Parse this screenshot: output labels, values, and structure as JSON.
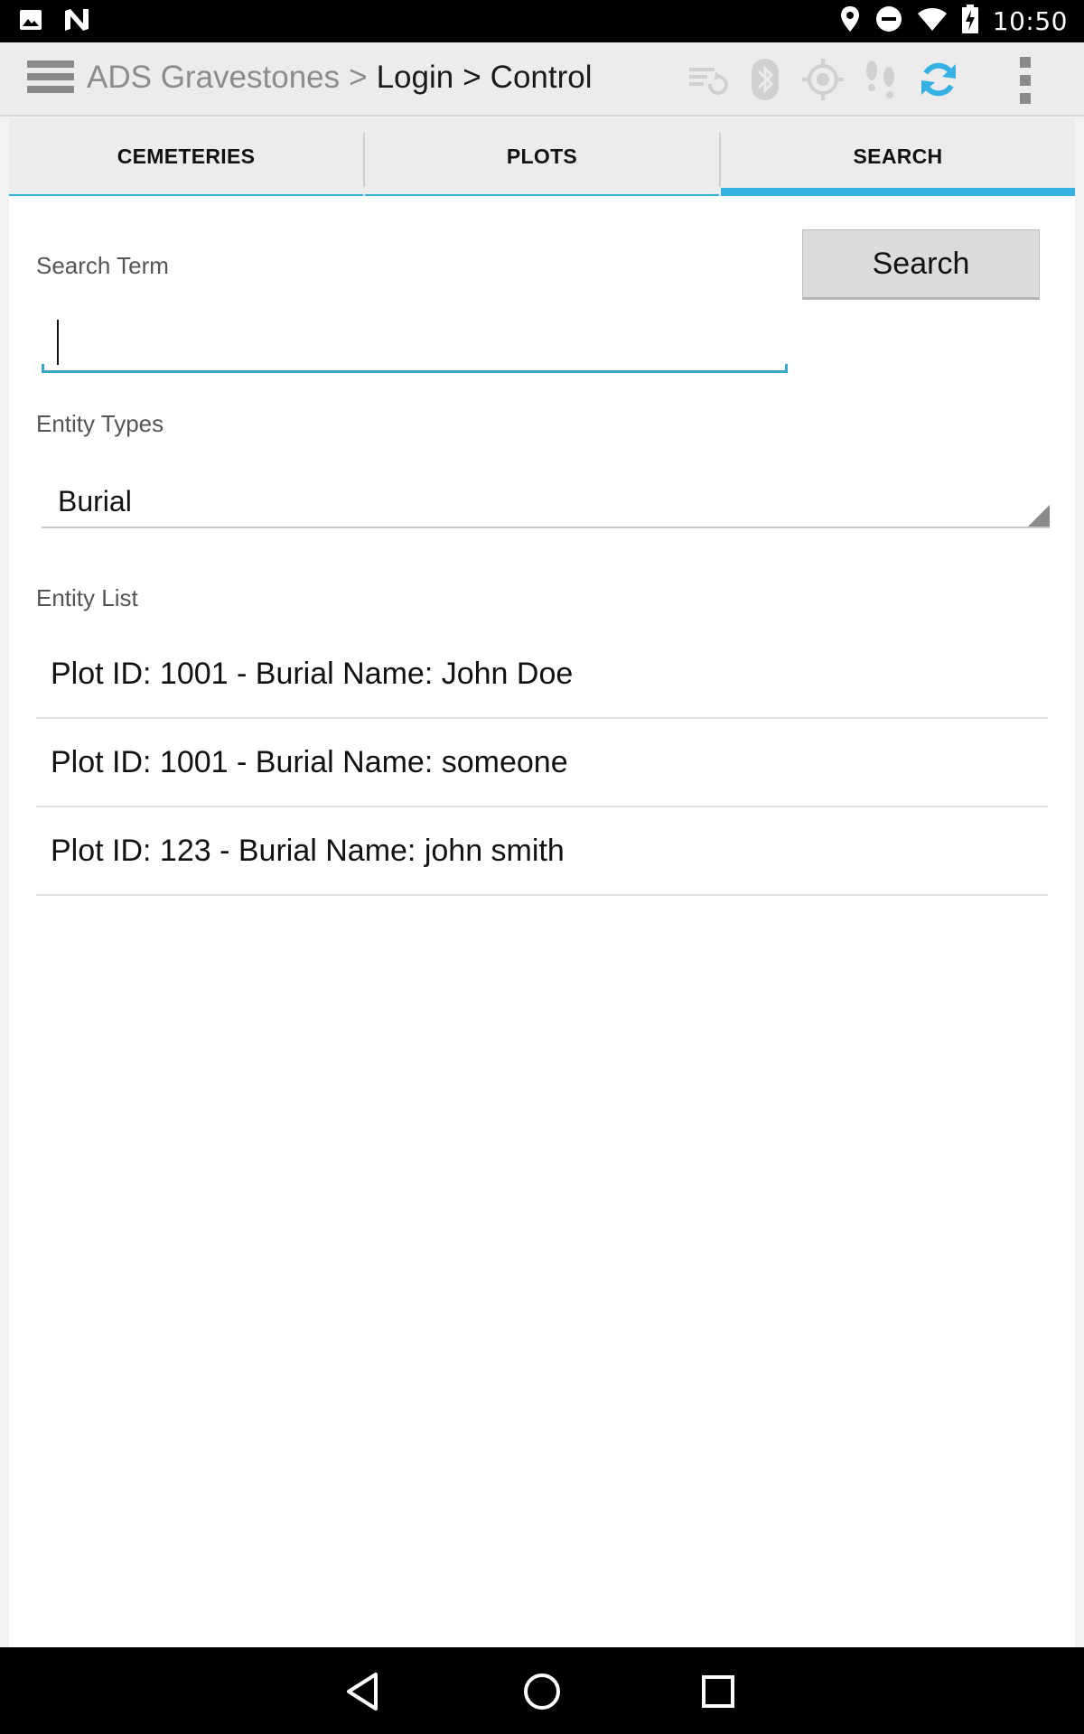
{
  "status_bar": {
    "time": "10:50",
    "icons": [
      "image-icon",
      "n-logo-icon",
      "location-icon",
      "do-not-disturb-icon",
      "wifi-icon",
      "battery-charging-icon"
    ]
  },
  "action_bar": {
    "app_title": "ADS Gravestones",
    "separator": ">",
    "crumb_1": "Login",
    "crumb_2": "Control",
    "icons": [
      "menu-icon",
      "sync-list-icon",
      "bluetooth-icon",
      "gps-target-icon",
      "footsteps-icon",
      "refresh-icon",
      "overflow-menu-icon"
    ],
    "accent_color": "#35b2e3"
  },
  "tabs": [
    {
      "label": "CEMETERIES",
      "active": false
    },
    {
      "label": "PLOTS",
      "active": false
    },
    {
      "label": "SEARCH",
      "active": true
    }
  ],
  "search": {
    "term_label": "Search Term",
    "term_value": "",
    "button_label": "Search",
    "entity_types_label": "Entity Types",
    "entity_type_selected": "Burial",
    "entity_list_label": "Entity List"
  },
  "entity_list": [
    "Plot ID: 1001 - Burial Name: John Doe",
    "Plot ID: 1001 - Burial Name: someone",
    "Plot ID: 123 - Burial Name: john smith"
  ],
  "nav_bar": {
    "icons": [
      "back-icon",
      "home-icon",
      "recents-icon"
    ]
  }
}
